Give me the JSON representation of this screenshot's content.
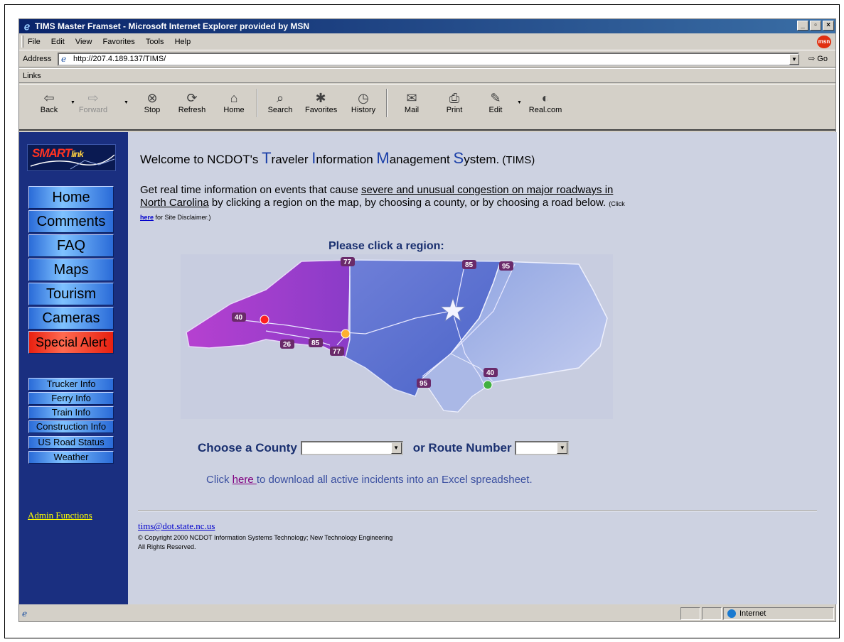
{
  "window": {
    "title": "TIMS Master Framset - Microsoft Internet Explorer provided by MSN",
    "controls": [
      "_",
      "▫",
      "×"
    ]
  },
  "menubar": {
    "items": [
      "File",
      "Edit",
      "View",
      "Favorites",
      "Tools",
      "Help"
    ],
    "msn_label": "msn"
  },
  "addressbar": {
    "label": "Address",
    "url": "http://207.4.189.137/TIMS/",
    "go_label": "Go"
  },
  "linksbar": {
    "label": "Links"
  },
  "toolbar": {
    "buttons": [
      {
        "label": "Back",
        "icon": "back-arrow-icon"
      },
      {
        "label": "Forward",
        "icon": "forward-arrow-icon"
      },
      {
        "label": "Stop",
        "icon": "stop-icon"
      },
      {
        "label": "Refresh",
        "icon": "refresh-icon"
      },
      {
        "label": "Home",
        "icon": "home-icon"
      },
      {
        "label": "Search",
        "icon": "search-icon"
      },
      {
        "label": "Favorites",
        "icon": "favorites-icon"
      },
      {
        "label": "History",
        "icon": "history-icon"
      },
      {
        "label": "Mail",
        "icon": "mail-icon"
      },
      {
        "label": "Print",
        "icon": "print-icon"
      },
      {
        "label": "Edit",
        "icon": "edit-icon"
      },
      {
        "label": "Real.com",
        "icon": "real-com-icon"
      }
    ]
  },
  "sidebar": {
    "logo_text": "SMART",
    "logo_sub": "link",
    "main_nav": [
      {
        "label": "Home"
      },
      {
        "label": "Comments"
      },
      {
        "label": "FAQ"
      },
      {
        "label": "Maps"
      },
      {
        "label": "Tourism"
      },
      {
        "label": "Cameras"
      },
      {
        "label": "Special Alert"
      }
    ],
    "sub_nav": [
      {
        "label": "Trucker Info"
      },
      {
        "label": "Ferry Info"
      },
      {
        "label": "Train Info"
      },
      {
        "label": "Construction Info"
      },
      {
        "label": "US Road Status"
      },
      {
        "label": "Weather"
      }
    ],
    "admin_link": "Admin Functions",
    "colors": {
      "sidebar_bg": "#1a2f80",
      "alert": "#e82010",
      "nav": "#4a90e8",
      "admin_link": "#ffff00"
    }
  },
  "main": {
    "welcome_pre": "Welcome to NCDOT's ",
    "welcome_t": "T",
    "welcome_raveler": "raveler ",
    "welcome_i": "I",
    "welcome_nformation": "nformation ",
    "welcome_m": "M",
    "welcome_anagement": "anagement ",
    "welcome_s": "S",
    "welcome_ystem": "ystem.",
    "welcome_acronym": " (TIMS)",
    "intro_pre": "Get real time information on events that cause ",
    "intro_underlined": "severe and unusual congestion on major roadways in North Carolina",
    "intro_post": " by clicking a region on the map, by choosing a county, or by choosing a road below.",
    "disclaimer_pre": "(Click ",
    "disclaimer_link": "here",
    "disclaimer_post": " for Site Disclaimer.)",
    "region_prompt": "Please click a region:",
    "map_routes": [
      "77",
      "85",
      "95",
      "40",
      "26",
      "85",
      "77",
      "95",
      "40"
    ],
    "county_label": "Choose a County",
    "county_value": "",
    "route_label": "or Route Number",
    "route_value": "",
    "download_pre": "Click ",
    "download_link": "here ",
    "download_post": "to download all active incidents into an Excel spreadsheet.",
    "footer_email": "tims@dot.state.nc.us",
    "footer_copyright": "© Copyright 2000 NCDOT Information Systems Technology; New Technology Engineering",
    "footer_rights": "All Rights Reserved."
  },
  "statusbar": {
    "zone": "Internet"
  }
}
